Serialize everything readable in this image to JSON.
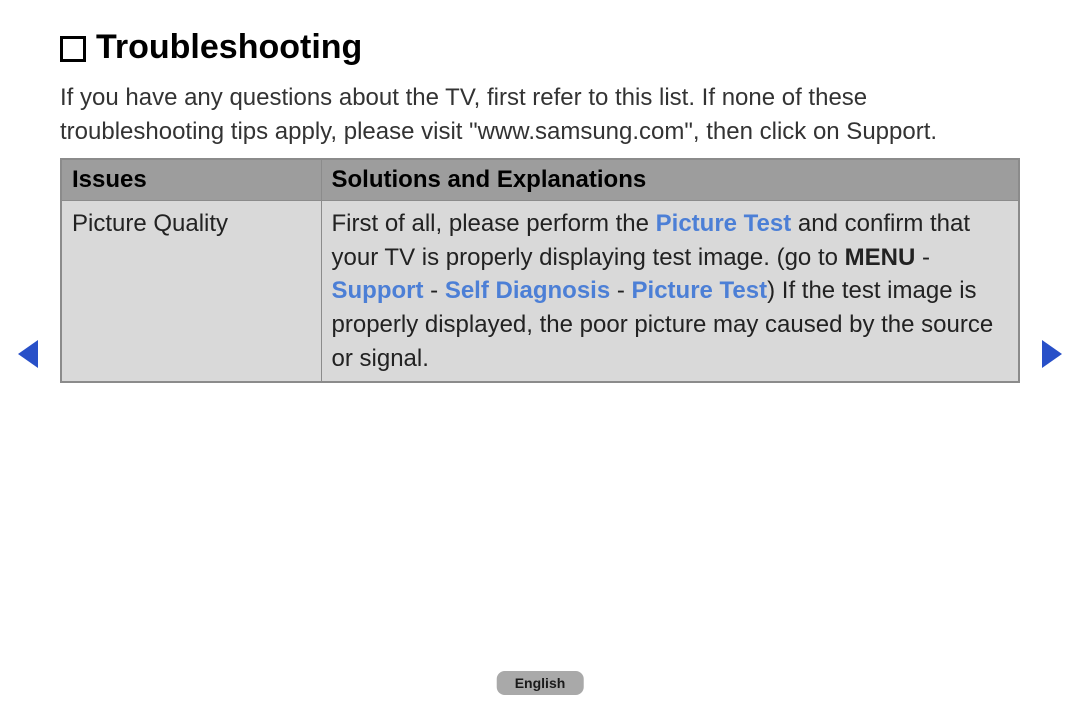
{
  "heading": "Troubleshooting",
  "intro": "If you have any questions about the TV, first refer to this list. If none of these troubleshooting tips apply, please visit \"www.samsung.com\", then click on Support.",
  "table": {
    "headers": {
      "col1": "Issues",
      "col2": "Solutions and Explanations"
    },
    "row": {
      "issue": "Picture Quality",
      "solution": {
        "t1": "First of all, please perform the ",
        "picture_test1": "Picture Test",
        "t2": " and confirm that your TV is properly displaying test image. (go to ",
        "menu": "MENU",
        "t3": " - ",
        "support": "Support",
        "t4": " - ",
        "self_diag": "Self Diagnosis",
        "t5": " - ",
        "picture_test2": "Picture Test",
        "t6": ") If the test image is properly displayed, the poor picture may caused by the source or signal."
      }
    }
  },
  "language": "English"
}
